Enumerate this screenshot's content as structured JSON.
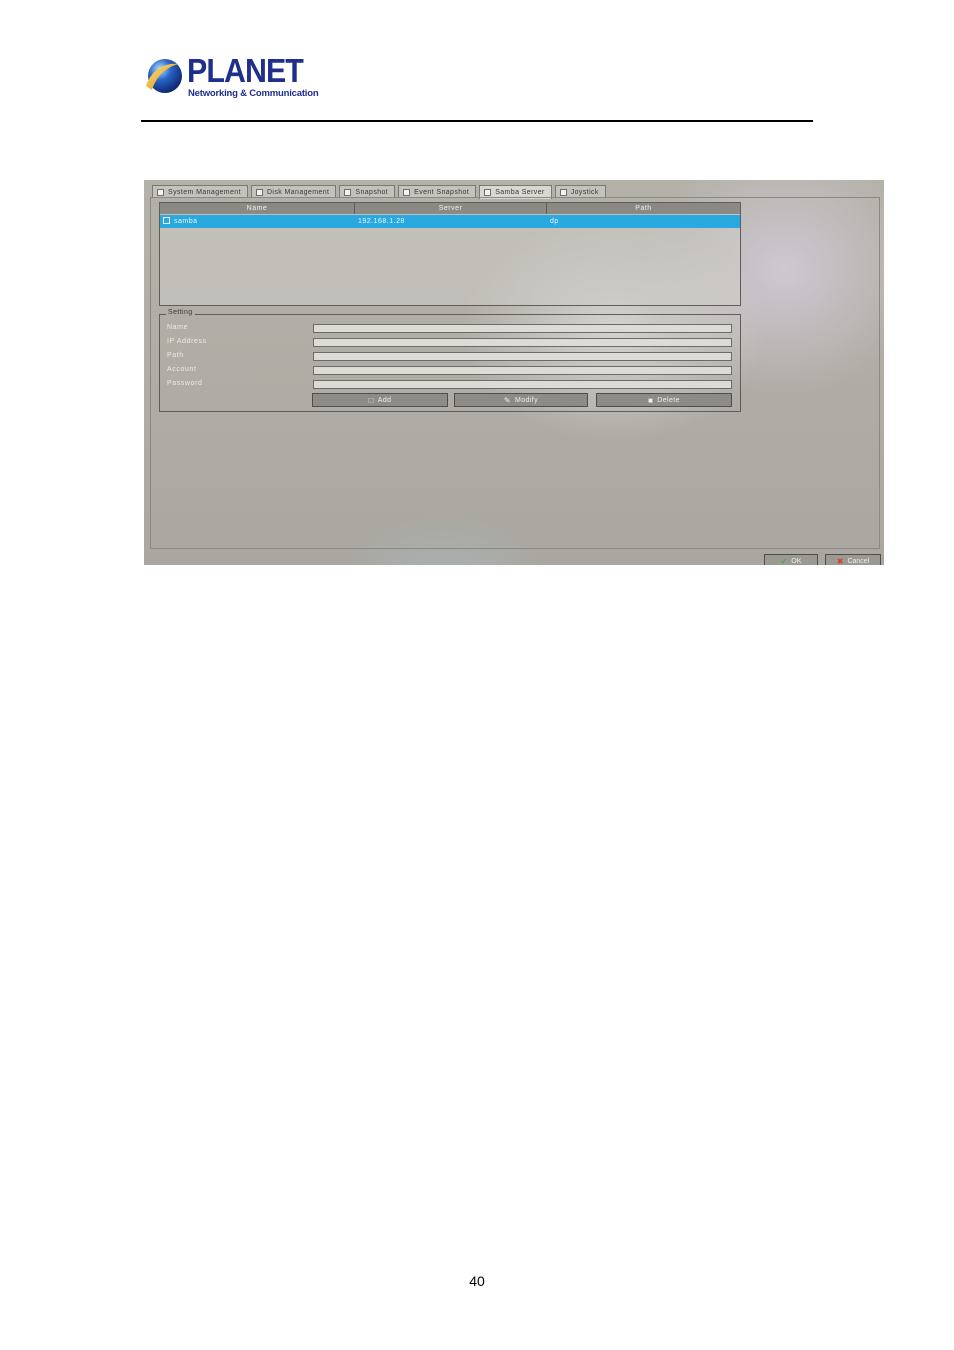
{
  "header": {
    "logo_name": "PLANET",
    "logo_tagline": "Networking & Communication"
  },
  "screenshot": {
    "tabs": [
      {
        "label": "System Management",
        "icon": "document-icon"
      },
      {
        "label": "Disk Management",
        "icon": "disk-icon"
      },
      {
        "label": "Snapshot",
        "icon": "camera-icon"
      },
      {
        "label": "Event Snapshot",
        "icon": "event-camera-icon"
      },
      {
        "label": "Samba Server",
        "icon": "server-icon",
        "active": true
      },
      {
        "label": "Joystick",
        "icon": "joystick-icon"
      }
    ],
    "list": {
      "columns": [
        "Name",
        "Server",
        "Path"
      ],
      "rows": [
        {
          "name": "samba",
          "server": "192.168.1.28",
          "path": "dp"
        }
      ]
    },
    "setting": {
      "legend": "Setting",
      "fields": [
        {
          "label": "Name",
          "value": ""
        },
        {
          "label": "IP Address",
          "value": ""
        },
        {
          "label": "Path",
          "value": ""
        },
        {
          "label": "Account",
          "value": ""
        },
        {
          "label": "Password",
          "value": ""
        }
      ],
      "buttons": {
        "add": "Add",
        "modify": "Modify",
        "delete": "Delete"
      }
    },
    "footer": {
      "ok": "OK",
      "cancel": "Cancel"
    },
    "colors": {
      "selection": "#2aa9e0",
      "ok_check": "#3cb043",
      "cancel_x": "#e03a2a"
    }
  },
  "page_number": "40"
}
